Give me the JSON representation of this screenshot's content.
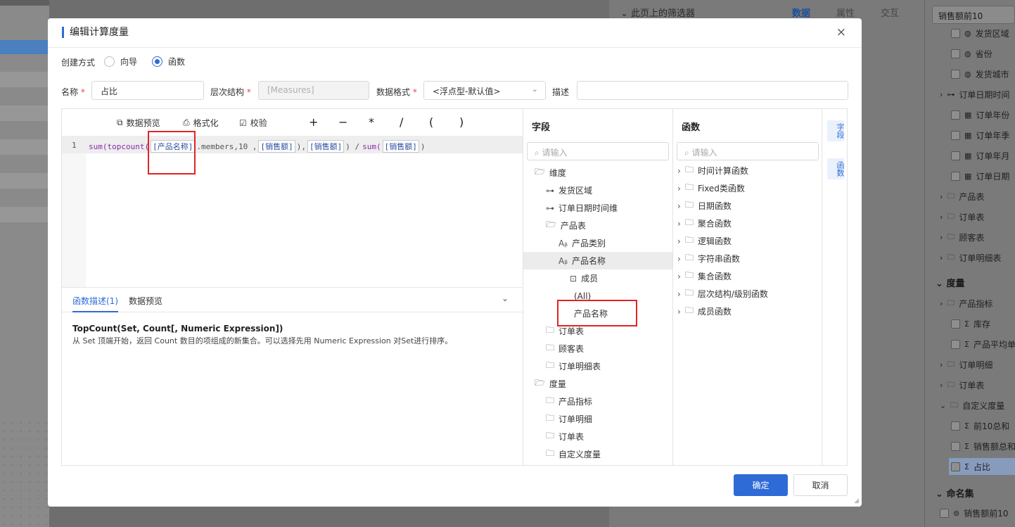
{
  "background": {
    "left_rows": 10,
    "right_panel": {
      "filter_heading": "此页上的筛选器",
      "tabs": [
        "数据",
        "属性",
        "交互"
      ],
      "search_value": "销售额前10",
      "items": [
        {
          "label": "发货区域",
          "icon": "globe-icon"
        },
        {
          "label": "省份",
          "icon": "globe-icon"
        },
        {
          "label": "发货城市",
          "icon": "globe-icon"
        },
        {
          "label": "订单日期时间",
          "icon": "hierarchy-icon"
        },
        {
          "label": "订单年份",
          "icon": "date-icon"
        },
        {
          "label": "订单年季",
          "icon": "date-icon"
        },
        {
          "label": "订单年月",
          "icon": "date-icon"
        },
        {
          "label": "订单日期",
          "icon": "date-icon"
        },
        {
          "label": "产品表",
          "icon": "folder-icon"
        },
        {
          "label": "订单表",
          "icon": "folder-icon"
        },
        {
          "label": "顾客表",
          "icon": "folder-icon"
        },
        {
          "label": "订单明细表",
          "icon": "folder-icon"
        }
      ],
      "measure_group": "度量",
      "measure_items": [
        {
          "label": "产品指标",
          "icon": "folder-icon"
        },
        {
          "label": "库存",
          "icon": "sigma-icon"
        },
        {
          "label": "产品平均单",
          "icon": "sigma-icon"
        },
        {
          "label": "订单明细",
          "icon": "folder-icon"
        },
        {
          "label": "订单表",
          "icon": "folder-icon"
        },
        {
          "label": "自定义度量",
          "icon": "folder-icon"
        },
        {
          "label": "前10总和",
          "icon": "calc-icon"
        },
        {
          "label": "销售额总和",
          "icon": "calc-icon"
        },
        {
          "label": "占比",
          "icon": "calc-icon"
        }
      ],
      "named_set_group": "命名集",
      "named_set_item": "销售额前10"
    }
  },
  "dialog": {
    "title": "编辑计算度量",
    "close_icon": "×",
    "create_method_label": "创建方式",
    "radio_wizard": "向导",
    "radio_function": "函数",
    "name_label": "名称",
    "name_value": "占比",
    "hierarchy_label": "层次结构",
    "hierarchy_value": "[Measures]",
    "format_label": "数据格式",
    "format_value": "<浮点型-默认值>",
    "desc_label": "描述",
    "desc_value": "",
    "required_mark": "*",
    "toolbar": {
      "preview": "数据预览",
      "format": "格式化",
      "validate": "校验",
      "ops": [
        "+",
        "−",
        "*",
        "/",
        "(",
        ")"
      ]
    },
    "editor": {
      "line_number": "1",
      "code_tokens": {
        "t1": "sum(",
        "t2": "topcount(",
        "t3": "[产品名称]",
        "t4": ".members,10 ,",
        "t5": "[销售额]",
        "t6": "),",
        "t7": "[销售额]",
        "t8": ") /",
        "t9": "sum(",
        "t10": "[销售额]",
        "t11": ")"
      }
    },
    "desc_tabs": [
      "函数描述(1)",
      "数据预览"
    ],
    "desc_title": "TopCount(Set, Count[, Numeric Expression])",
    "desc_text": "从 Set 顶端开始，返回 Count 数目的项组成的新集合。可以选择先用 Numeric Expression 对Set进行排序。",
    "field_pane": {
      "title": "字段",
      "placeholder": "请输入",
      "items": [
        {
          "label": "维度",
          "indent": 0,
          "icon": "folder-open-icon"
        },
        {
          "label": "发货区域",
          "indent": 1,
          "icon": "hierarchy-icon"
        },
        {
          "label": "订单日期时间维",
          "indent": 1,
          "icon": "hierarchy-icon"
        },
        {
          "label": "产品表",
          "indent": 1,
          "icon": "folder-open-icon"
        },
        {
          "label": "产品类别",
          "indent": 2,
          "icon": "text-field-icon"
        },
        {
          "label": "产品名称",
          "indent": 2,
          "icon": "text-field-icon"
        },
        {
          "label": "成员",
          "indent": 3,
          "icon": "member-icon"
        },
        {
          "label": "(All)",
          "indent": 3,
          "icon": ""
        },
        {
          "label": "产品名称",
          "indent": 3,
          "icon": ""
        },
        {
          "label": "订单表",
          "indent": 1,
          "icon": "folder-icon"
        },
        {
          "label": "顾客表",
          "indent": 1,
          "icon": "folder-icon"
        },
        {
          "label": "订单明细表",
          "indent": 1,
          "icon": "folder-icon"
        },
        {
          "label": "度量",
          "indent": 0,
          "icon": "folder-open-icon"
        },
        {
          "label": "产品指标",
          "indent": 1,
          "icon": "folder-icon"
        },
        {
          "label": "订单明细",
          "indent": 1,
          "icon": "folder-icon"
        },
        {
          "label": "订单表",
          "indent": 1,
          "icon": "folder-icon"
        },
        {
          "label": "自定义度量",
          "indent": 1,
          "icon": "folder-icon"
        }
      ]
    },
    "func_pane": {
      "title": "函数",
      "placeholder": "请输入",
      "items": [
        "时间计算函数",
        "Fixed类函数",
        "日期函数",
        "聚合函数",
        "逻辑函数",
        "字符串函数",
        "集合函数",
        "层次结构/级别函数",
        "成员函数"
      ]
    },
    "side_tabs": [
      "字段",
      "函数"
    ],
    "ok_label": "确定",
    "cancel_label": "取消"
  },
  "colors": {
    "accent": "#2f6bd6",
    "highlight_box": "#e02424"
  }
}
